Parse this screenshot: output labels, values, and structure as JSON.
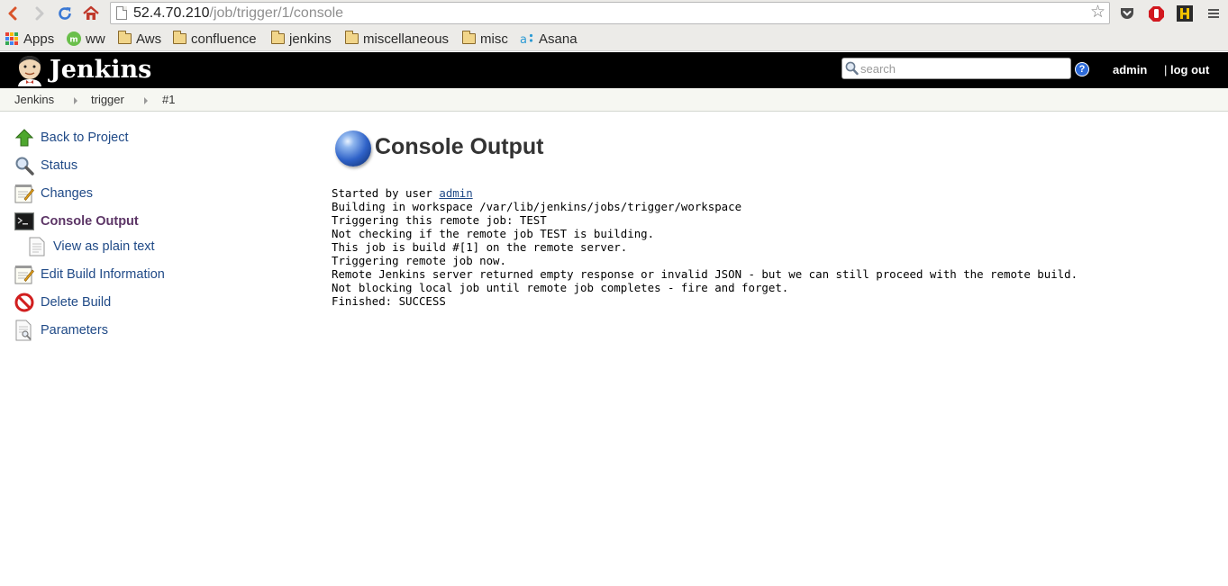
{
  "browser": {
    "url_host": "52.4.70.210",
    "url_path": "/job/trigger/1/console",
    "bookmarks": [
      {
        "label": "Apps",
        "kind": "apps"
      },
      {
        "label": "ww",
        "kind": "mint"
      },
      {
        "label": "Aws",
        "kind": "folder"
      },
      {
        "label": "confluence",
        "kind": "folder"
      },
      {
        "label": "jenkins",
        "kind": "folder"
      },
      {
        "label": "miscellaneous",
        "kind": "folder"
      },
      {
        "label": "misc",
        "kind": "folder"
      },
      {
        "label": "Asana",
        "kind": "asana"
      }
    ]
  },
  "header": {
    "title": "Jenkins",
    "search_placeholder": "search",
    "help_glyph": "?",
    "user": "admin",
    "logout": "log out",
    "logout_sep": "| "
  },
  "breadcrumbs": [
    "Jenkins",
    "trigger",
    "#1"
  ],
  "sidebar": {
    "items": [
      {
        "label": "Back to Project",
        "icon": "up-arrow-icon"
      },
      {
        "label": "Status",
        "icon": "magnifier-icon"
      },
      {
        "label": "Changes",
        "icon": "notepad-icon"
      },
      {
        "label": "Console Output",
        "icon": "terminal-icon",
        "current": true
      },
      {
        "label": "View as plain text",
        "icon": "document-icon",
        "sub": true
      },
      {
        "label": "Edit Build Information",
        "icon": "notepad-icon"
      },
      {
        "label": "Delete Build",
        "icon": "no-entry-icon"
      },
      {
        "label": "Parameters",
        "icon": "document-search-icon"
      }
    ]
  },
  "main": {
    "title": "Console Output",
    "status_ball_color": "#2f62c8",
    "console": {
      "started_prefix": "Started by user ",
      "started_user": "admin",
      "lines": [
        "Building in workspace /var/lib/jenkins/jobs/trigger/workspace",
        "Triggering this remote job: TEST",
        "Not checking if the remote job TEST is building.",
        "This job is build #[1] on the remote server.",
        "Triggering remote job now.",
        "Remote Jenkins server returned empty response or invalid JSON - but we can still proceed with the remote build.",
        "Not blocking local job until remote job completes - fire and forget.",
        "Finished: SUCCESS"
      ]
    }
  },
  "colors": {
    "header_bg": "#000000",
    "link": "#204a87",
    "current_task": "#5c3566",
    "crumb_bg": "#f6f7f2"
  }
}
